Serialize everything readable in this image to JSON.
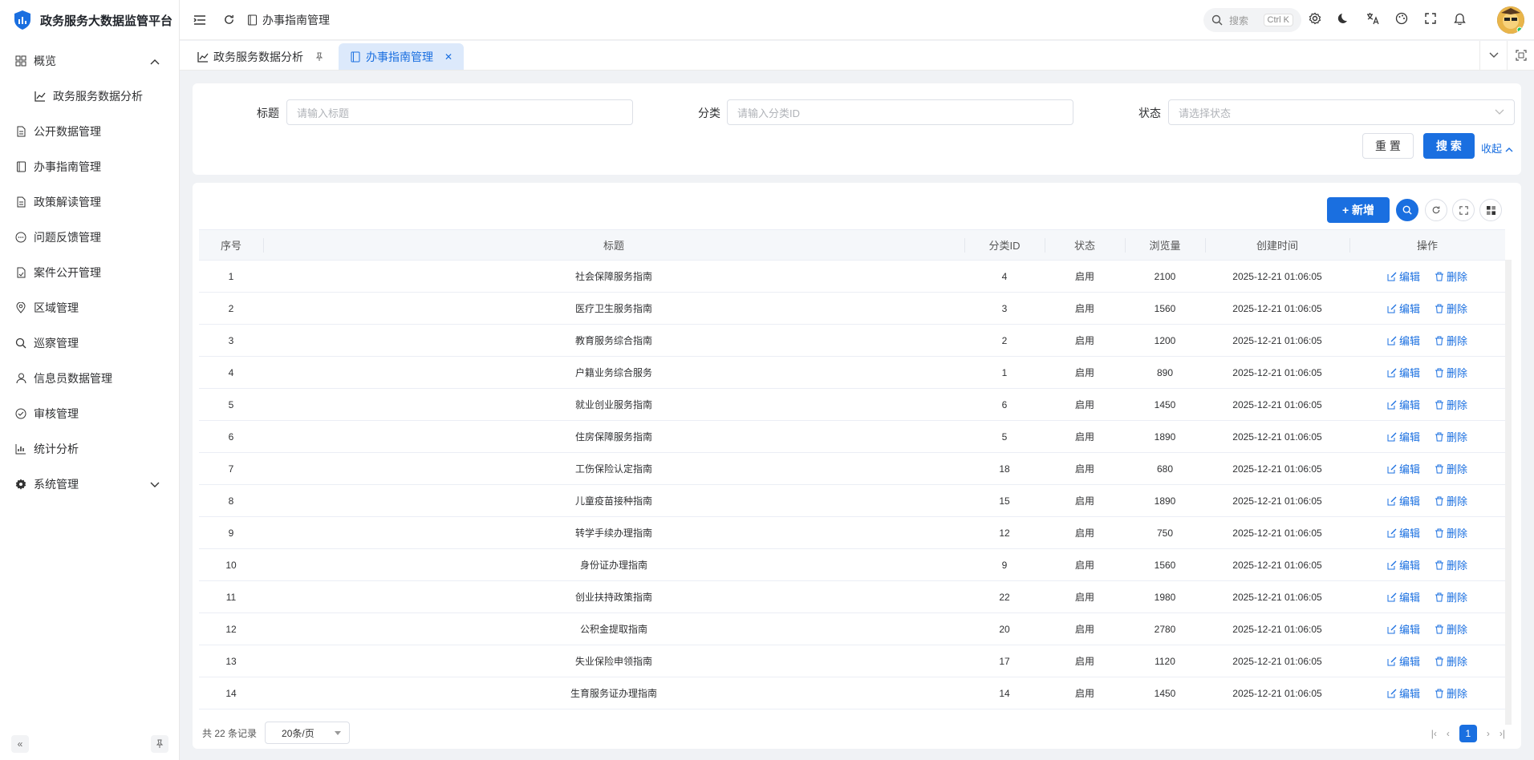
{
  "app": {
    "title": "政务服务大数据监管平台"
  },
  "sidebar": {
    "items": [
      {
        "label": "概览",
        "icon": "dashboard-icon",
        "expanded": true
      },
      {
        "label": "政务服务数据分析",
        "icon": "chart-icon",
        "sub": true
      },
      {
        "label": "公开数据管理",
        "icon": "document-icon"
      },
      {
        "label": "办事指南管理",
        "icon": "book-icon"
      },
      {
        "label": "政策解读管理",
        "icon": "document-icon"
      },
      {
        "label": "问题反馈管理",
        "icon": "message-icon"
      },
      {
        "label": "案件公开管理",
        "icon": "file-check-icon"
      },
      {
        "label": "区域管理",
        "icon": "location-icon"
      },
      {
        "label": "巡察管理",
        "icon": "search-icon"
      },
      {
        "label": "信息员数据管理",
        "icon": "user-icon"
      },
      {
        "label": "审核管理",
        "icon": "check-circle-icon"
      },
      {
        "label": "统计分析",
        "icon": "bar-chart-icon"
      },
      {
        "label": "系统管理",
        "icon": "gear-icon",
        "collapsed": true
      }
    ]
  },
  "header": {
    "breadcrumb": "办事指南管理",
    "search_placeholder": "搜索",
    "search_shortcut": "Ctrl K"
  },
  "tabs": [
    {
      "label": "政务服务数据分析",
      "active": false
    },
    {
      "label": "办事指南管理",
      "active": true
    }
  ],
  "form": {
    "title_label": "标题",
    "title_placeholder": "请输入标题",
    "category_label": "分类",
    "category_placeholder": "请输入分类ID",
    "status_label": "状态",
    "status_placeholder": "请选择状态",
    "reset_label": "重 置",
    "search_label": "搜 索",
    "collapse_label": "收起"
  },
  "toolbar": {
    "add_label": "+ 新增"
  },
  "table": {
    "columns": [
      "序号",
      "标题",
      "分类ID",
      "状态",
      "浏览量",
      "创建时间",
      "操作"
    ],
    "edit_label": "编辑",
    "delete_label": "删除",
    "rows": [
      {
        "no": "1",
        "title": "社会保障服务指南",
        "cat": "4",
        "status": "启用",
        "views": "2100",
        "created": "2025-12-21 01:06:05"
      },
      {
        "no": "2",
        "title": "医疗卫生服务指南",
        "cat": "3",
        "status": "启用",
        "views": "1560",
        "created": "2025-12-21 01:06:05"
      },
      {
        "no": "3",
        "title": "教育服务综合指南",
        "cat": "2",
        "status": "启用",
        "views": "1200",
        "created": "2025-12-21 01:06:05"
      },
      {
        "no": "4",
        "title": "户籍业务综合服务",
        "cat": "1",
        "status": "启用",
        "views": "890",
        "created": "2025-12-21 01:06:05"
      },
      {
        "no": "5",
        "title": "就业创业服务指南",
        "cat": "6",
        "status": "启用",
        "views": "1450",
        "created": "2025-12-21 01:06:05"
      },
      {
        "no": "6",
        "title": "住房保障服务指南",
        "cat": "5",
        "status": "启用",
        "views": "1890",
        "created": "2025-12-21 01:06:05"
      },
      {
        "no": "7",
        "title": "工伤保险认定指南",
        "cat": "18",
        "status": "启用",
        "views": "680",
        "created": "2025-12-21 01:06:05"
      },
      {
        "no": "8",
        "title": "儿童疫苗接种指南",
        "cat": "15",
        "status": "启用",
        "views": "1890",
        "created": "2025-12-21 01:06:05"
      },
      {
        "no": "9",
        "title": "转学手续办理指南",
        "cat": "12",
        "status": "启用",
        "views": "750",
        "created": "2025-12-21 01:06:05"
      },
      {
        "no": "10",
        "title": "身份证办理指南",
        "cat": "9",
        "status": "启用",
        "views": "1560",
        "created": "2025-12-21 01:06:05"
      },
      {
        "no": "11",
        "title": "创业扶持政策指南",
        "cat": "22",
        "status": "启用",
        "views": "1980",
        "created": "2025-12-21 01:06:05"
      },
      {
        "no": "12",
        "title": "公积金提取指南",
        "cat": "20",
        "status": "启用",
        "views": "2780",
        "created": "2025-12-21 01:06:05"
      },
      {
        "no": "13",
        "title": "失业保险申领指南",
        "cat": "17",
        "status": "启用",
        "views": "1120",
        "created": "2025-12-21 01:06:05"
      },
      {
        "no": "14",
        "title": "生育服务证办理指南",
        "cat": "14",
        "status": "启用",
        "views": "1450",
        "created": "2025-12-21 01:06:05"
      }
    ]
  },
  "pagination": {
    "total_text": "共 22 条记录",
    "page_size": "20条/页",
    "current_page": "1"
  },
  "colors": {
    "accent": "#1a6fe0",
    "tab_active_bg": "#dce9fb"
  }
}
